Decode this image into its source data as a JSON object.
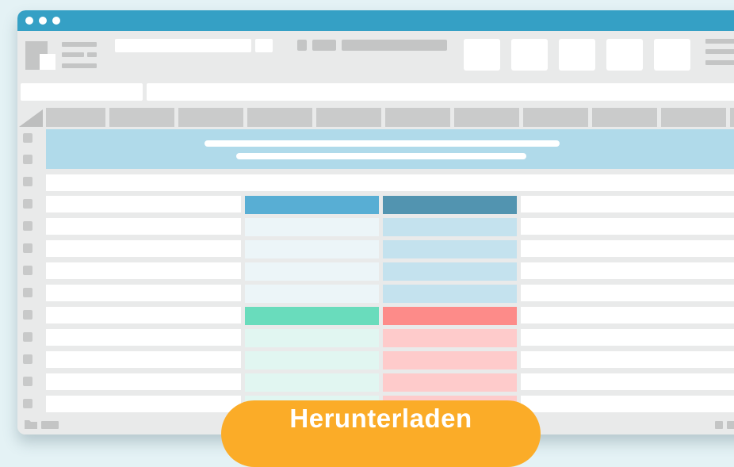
{
  "download": {
    "label": "Herunterladen"
  },
  "colors": {
    "page_background": "#e4f2f5",
    "titlebar": "#35a0c5",
    "button": "#fbac28",
    "merged_banner": "#b0daea",
    "header_blue": "#58aed4",
    "header_steel": "#5294b0",
    "header_green": "#69dcbc",
    "header_red": "#fd8b89",
    "cell_light_blue": "#ecf5f8",
    "cell_blue": "#c4e2ee",
    "cell_light_green": "#e1f6f1",
    "cell_pink": "#fecbcb"
  },
  "icons": [
    "app-logo-icon",
    "menu-lines-icon",
    "hamburger-icon",
    "folder-icon",
    "sheet-tab-icon",
    "resize-handle-icon"
  ]
}
